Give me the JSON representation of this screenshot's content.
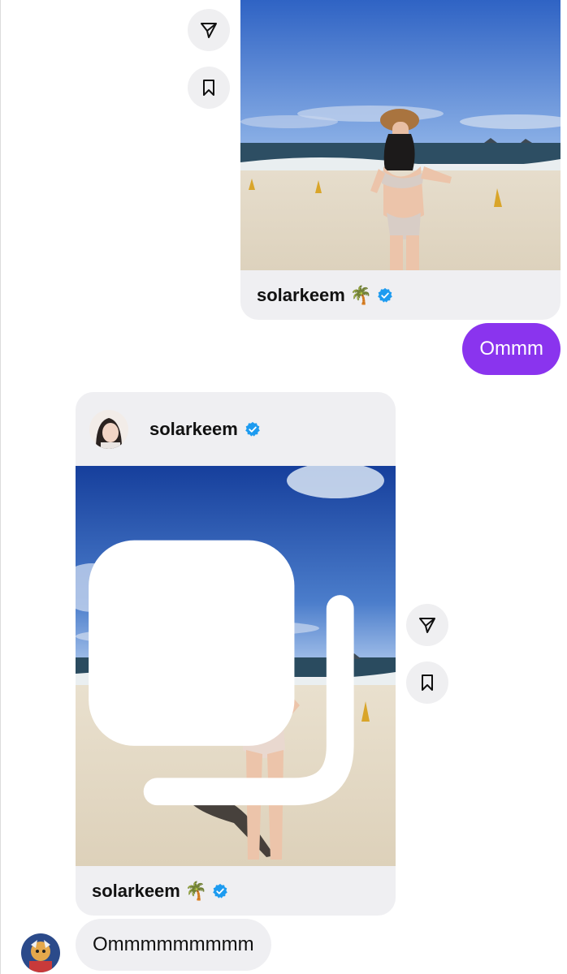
{
  "messages": {
    "card1": {
      "username": "solarkeem",
      "emoji": "🌴",
      "verified": true
    },
    "sent_reply": "Ommm",
    "card2": {
      "header_username": "solarkeem",
      "footer_username": "solarkeem",
      "emoji": "🌴",
      "verified": true,
      "is_multi_photo": true
    },
    "received_reply": "Ommmmmmmmm"
  },
  "icons": {
    "share": "paper-plane-icon",
    "save": "bookmark-icon",
    "verified": "verified-badge-icon",
    "multi": "carousel-icon"
  },
  "colors": {
    "sent_bubble": "#8a34ee",
    "received_bubble": "#efeff2",
    "card_bg": "#efeff2",
    "verified_blue": "#1d9bf0",
    "action_btn_bg": "#efeff1"
  }
}
